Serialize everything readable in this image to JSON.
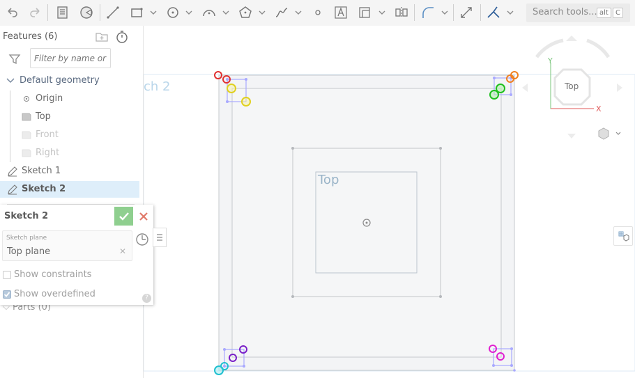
{
  "toolbar": {
    "tools": [
      "undo-icon",
      "redo-icon",
      "use-icon",
      "trim-icon",
      "line-icon",
      "rectangle-icon",
      "circle-icon",
      "arc-icon",
      "polygon-icon",
      "spline-icon",
      "point-icon",
      "text-icon",
      "offset-icon",
      "mirror-icon",
      "fillet-icon",
      "dimension-icon",
      "constraint-icon"
    ],
    "search": {
      "placeholder": "Search tools...",
      "shortcut_key1": "alt",
      "shortcut_key2": "C"
    }
  },
  "panel": {
    "title": "Features (6)",
    "filter_placeholder": "Filter by name or type",
    "tree": [
      {
        "label": "Default geometry",
        "kind": "group"
      },
      {
        "label": "Origin",
        "kind": "origin"
      },
      {
        "label": "Top",
        "kind": "plane"
      },
      {
        "label": "Front",
        "kind": "plane"
      },
      {
        "label": "Right",
        "kind": "plane"
      },
      {
        "label": "Sketch 1",
        "kind": "sketch"
      },
      {
        "label": "Sketch 2",
        "kind": "sketch",
        "selected": true
      }
    ],
    "parts_label": "Parts (0)"
  },
  "dialog": {
    "title": "Sketch 2",
    "sketch_plane_label": "Sketch plane",
    "sketch_plane_value": "Top plane",
    "show_constraints_label": "Show constraints",
    "show_constraints_checked": false,
    "show_overdefined_label": "Show overdefined",
    "show_overdefined_checked": true
  },
  "viewport": {
    "background_sketch_label": "ch 2",
    "plane_label": "Top",
    "view_cube_face": "Top",
    "axis_y": "Y",
    "axis_x": "X"
  },
  "colors": {
    "accent_green": "#8fcf8f",
    "cancel_red": "#e07a6a",
    "selected_row": "#deeefa",
    "sketch_line": "#a9a9ff"
  }
}
